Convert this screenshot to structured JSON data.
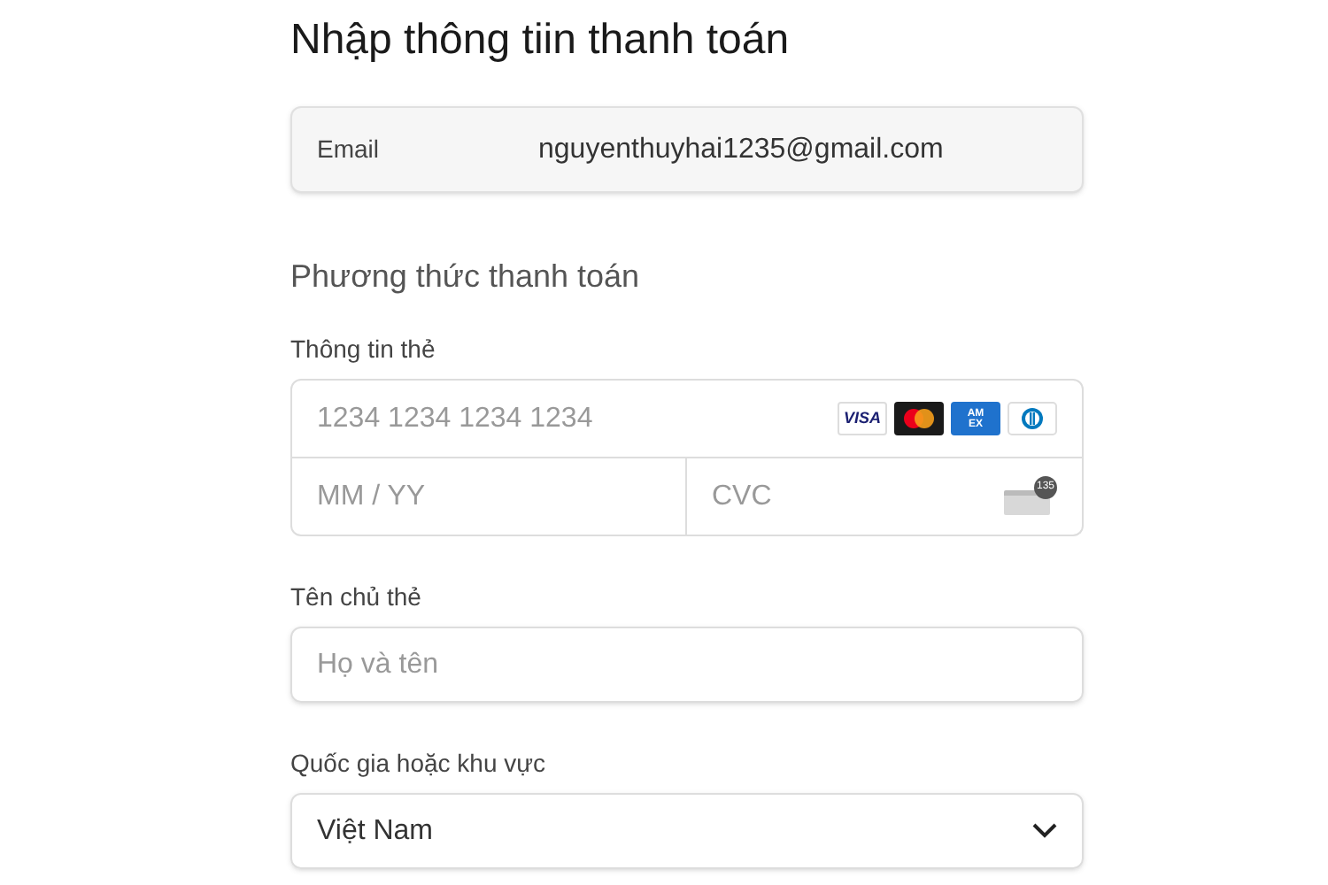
{
  "title": "Nhập thông tiin thanh toán",
  "email": {
    "label": "Email",
    "value": "nguyenthuyhai1235@gmail.com"
  },
  "section_title": "Phương thức thanh toán",
  "card": {
    "label": "Thông tin thẻ",
    "number_placeholder": "1234 1234 1234 1234",
    "expiry_placeholder": "MM / YY",
    "cvc_placeholder": "CVC",
    "cvc_badge": "135",
    "brands": [
      {
        "kind": "visa",
        "label": "VISA"
      },
      {
        "kind": "mastercard"
      },
      {
        "kind": "amex",
        "label": "AM EX"
      },
      {
        "kind": "diners"
      }
    ]
  },
  "cardholder": {
    "label": "Tên chủ thẻ",
    "placeholder": "Họ và tên"
  },
  "country": {
    "label": "Quốc gia hoặc khu vực",
    "value": "Việt Nam"
  }
}
